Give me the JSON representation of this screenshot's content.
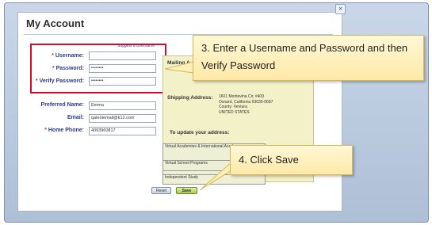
{
  "window": {
    "title": "My Account",
    "close_glyph": "×"
  },
  "credentials": {
    "suggest_link": "Suggest a Username",
    "username_label": "Username:",
    "password_label": "Password:",
    "verify_label": "Verify Password:",
    "required_mark": "*",
    "username_value": "",
    "password_value": "••••••••",
    "verify_value": "••••••••"
  },
  "profile": {
    "preferred_label": "Preferred Name:",
    "preferred_value": "Emma",
    "email_label": "Email:",
    "email_value": "qatestemail@k12.com",
    "phone_label": "Home Phone:",
    "phone_value": "4093960817"
  },
  "right_panel": {
    "mailing_label": "Mailing A",
    "shipping_label": "Shipping Address:",
    "shipping_lines": [
      "1601 Montevina Cir, #409",
      "Oxnard, California 93030-0687",
      "County: Ventura",
      "UNITED STATES"
    ],
    "update_text": "To update your address:",
    "list_items": [
      "Virtual Academies & International Academy",
      "Virtual School Programs",
      "Independent Study"
    ]
  },
  "buttons": {
    "reset_label": "Reset",
    "save_label": "Save"
  },
  "callouts": {
    "step3": "3. Enter a Username and Password and then Verify Password",
    "step4": "4. Click Save"
  },
  "colors": {
    "highlight_box": "#c8102e",
    "label_blue": "#2b3c8c",
    "save_green": "#a8c94a",
    "callout_fill": "#fff2c4"
  }
}
